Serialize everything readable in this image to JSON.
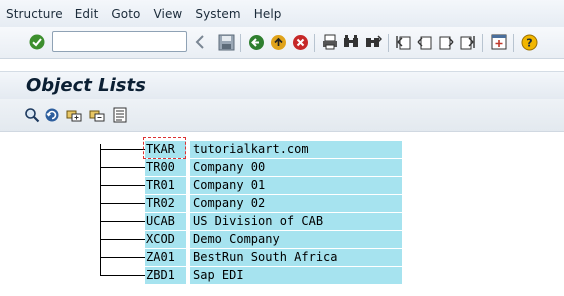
{
  "menu": {
    "items": [
      "Structure",
      "Edit",
      "Goto",
      "View",
      "System",
      "Help"
    ]
  },
  "toolbar": {
    "command_value": ""
  },
  "title": "Object Lists",
  "tree": {
    "rows": [
      {
        "key": "TKAR",
        "text": "tutorialkart.com"
      },
      {
        "key": "TR00",
        "text": "Company 00"
      },
      {
        "key": "TR01",
        "text": "Company 01"
      },
      {
        "key": "TR02",
        "text": "Company 02"
      },
      {
        "key": "UCAB",
        "text": "US Division of CAB"
      },
      {
        "key": "XCOD",
        "text": "Demo Company"
      },
      {
        "key": "ZA01",
        "text": "BestRun South Africa"
      },
      {
        "key": "ZBD1",
        "text": "Sap EDI"
      }
    ]
  },
  "colors": {
    "row_highlight": "#a6e3ef",
    "selection_border": "#dd3333"
  }
}
